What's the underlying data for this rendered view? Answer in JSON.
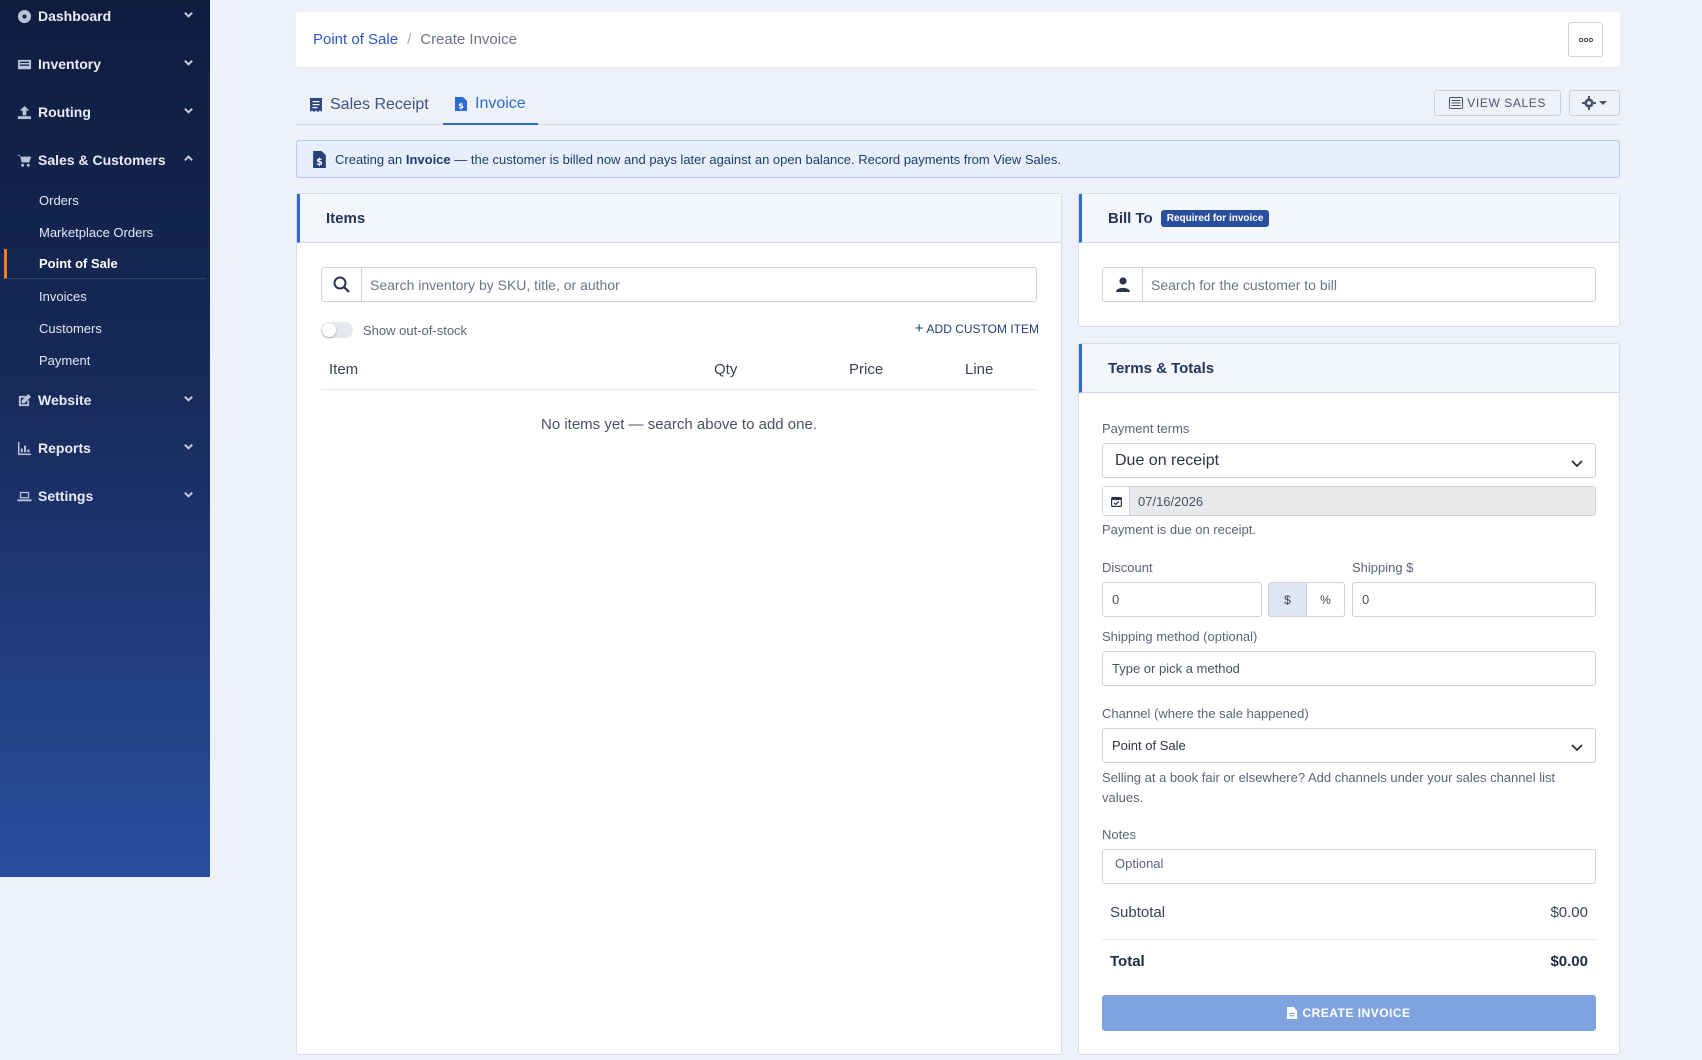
{
  "sidebar": {
    "groups": [
      {
        "label": "Dashboard",
        "icon": "dashboard-icon"
      },
      {
        "label": "Inventory",
        "icon": "inventory-icon"
      },
      {
        "label": "Routing",
        "icon": "routing-icon"
      },
      {
        "label": "Sales & Customers",
        "icon": "cart-icon",
        "expanded": true
      },
      {
        "label": "Website",
        "icon": "edit-icon"
      },
      {
        "label": "Reports",
        "icon": "chart-icon"
      },
      {
        "label": "Settings",
        "icon": "laptop-icon"
      }
    ],
    "sales_items": [
      "Orders",
      "Marketplace Orders",
      "Point of Sale",
      "Invoices",
      "Customers",
      "Payment"
    ],
    "active_item": "Point of Sale",
    "accent_color": "#f07a28"
  },
  "breadcrumb": {
    "parent": "Point of Sale",
    "separator": "/",
    "current": "Create Invoice"
  },
  "tabs": [
    {
      "label": "Sales Receipt",
      "icon": "receipt-icon"
    },
    {
      "label": "Invoice",
      "icon": "invoice-icon",
      "active": true
    }
  ],
  "toolbar": {
    "view_sales": "VIEW SALES"
  },
  "alert": {
    "prefix": "Creating an",
    "emphasis": "Invoice",
    "suffix": "— the customer is billed now and pays later against an open balance. Record payments from View Sales."
  },
  "items_card": {
    "title": "Items",
    "search_placeholder": "Search inventory by SKU, title, or author",
    "show_oos_label": "Show out-of-stock",
    "add_custom": "ADD CUSTOM ITEM",
    "columns": [
      "Item",
      "Qty",
      "Price",
      "Line"
    ],
    "empty_message": "No items yet — search above to add one."
  },
  "bill_to": {
    "title": "Bill To",
    "badge": "Required for invoice",
    "search_placeholder": "Search for the customer to bill"
  },
  "terms": {
    "title": "Terms & Totals",
    "payment_terms_label": "Payment terms",
    "payment_terms_value": "Due on receipt",
    "due_date": "07/16/2026",
    "due_note": "Payment is due on receipt.",
    "discount_label": "Discount",
    "discount_value": "0",
    "discount_modes": [
      "$",
      "%"
    ],
    "shipping_label": "Shipping $",
    "shipping_value": "0",
    "shipping_method_label": "Shipping method (optional)",
    "shipping_method_placeholder": "Type or pick a method",
    "channel_label": "Channel (where the sale happened)",
    "channel_value": "Point of Sale",
    "channel_help": "Selling at a book fair or elsewhere? Add channels under your sales channel list values.",
    "notes_label": "Notes",
    "notes_placeholder": "Optional",
    "subtotal_label": "Subtotal",
    "subtotal_value": "$0.00",
    "total_label": "Total",
    "total_value": "$0.00",
    "create_button": "CREATE INVOICE"
  },
  "colors": {
    "primary": "#2b6cd4",
    "sidebar_top": "#0e1c3e",
    "sidebar_bottom": "#2a4e9e",
    "button_disabled": "#7fa3df"
  }
}
